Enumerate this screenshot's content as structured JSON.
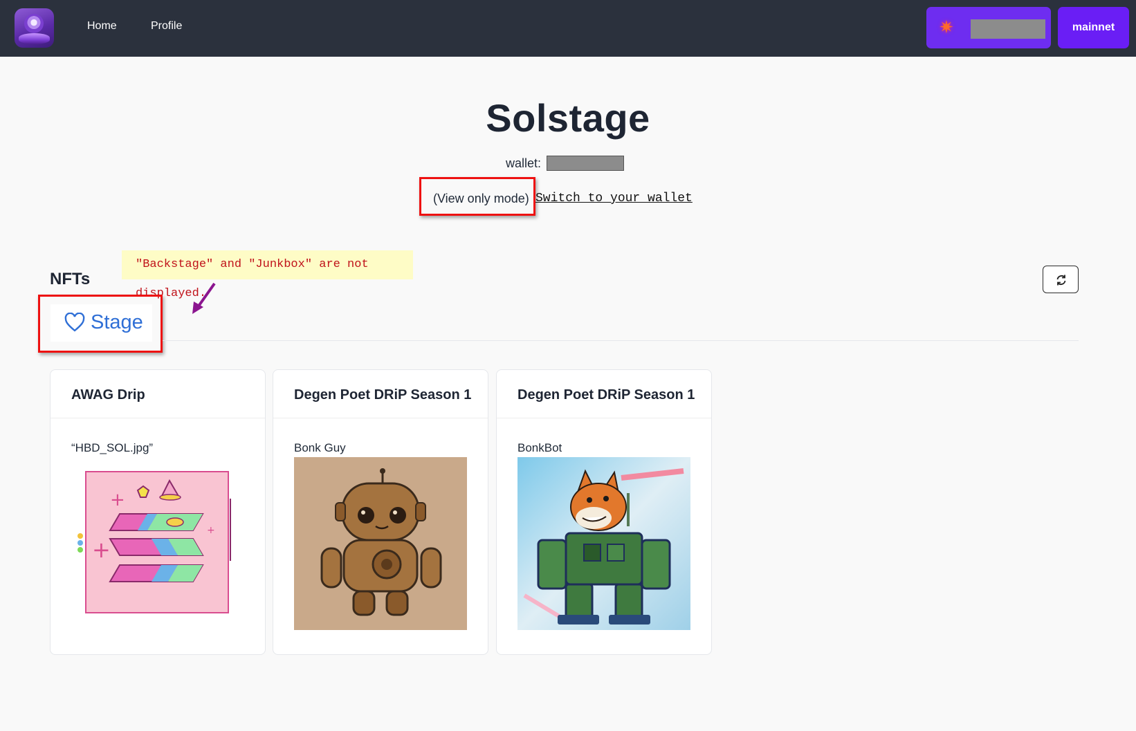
{
  "nav": {
    "links": [
      "Home",
      "Profile"
    ],
    "network_label": "mainnet"
  },
  "header": {
    "title": "Solstage",
    "wallet_prefix": "wallet:",
    "view_only_text": "(View only mode)",
    "switch_link": "Switch to your wallet"
  },
  "annotation": {
    "callout_text": "\"Backstage\" and \"Junkbox\" are not displayed."
  },
  "nfts": {
    "heading": "NFTs",
    "tab_label": "Stage",
    "cards": [
      {
        "collection": "AWAG Drip",
        "name": "“HBD_SOL.jpg”"
      },
      {
        "collection": "Degen Poet DRiP Season 1",
        "name": "Bonk Guy"
      },
      {
        "collection": "Degen Poet DRiP Season 1",
        "name": "BonkBot"
      }
    ]
  },
  "colors": {
    "navbar": "#2b313d",
    "accent_purple": "#6a1ef5",
    "link_blue": "#2f6fd6",
    "highlight_red": "#e11111",
    "callout_bg": "#fefcc6"
  }
}
